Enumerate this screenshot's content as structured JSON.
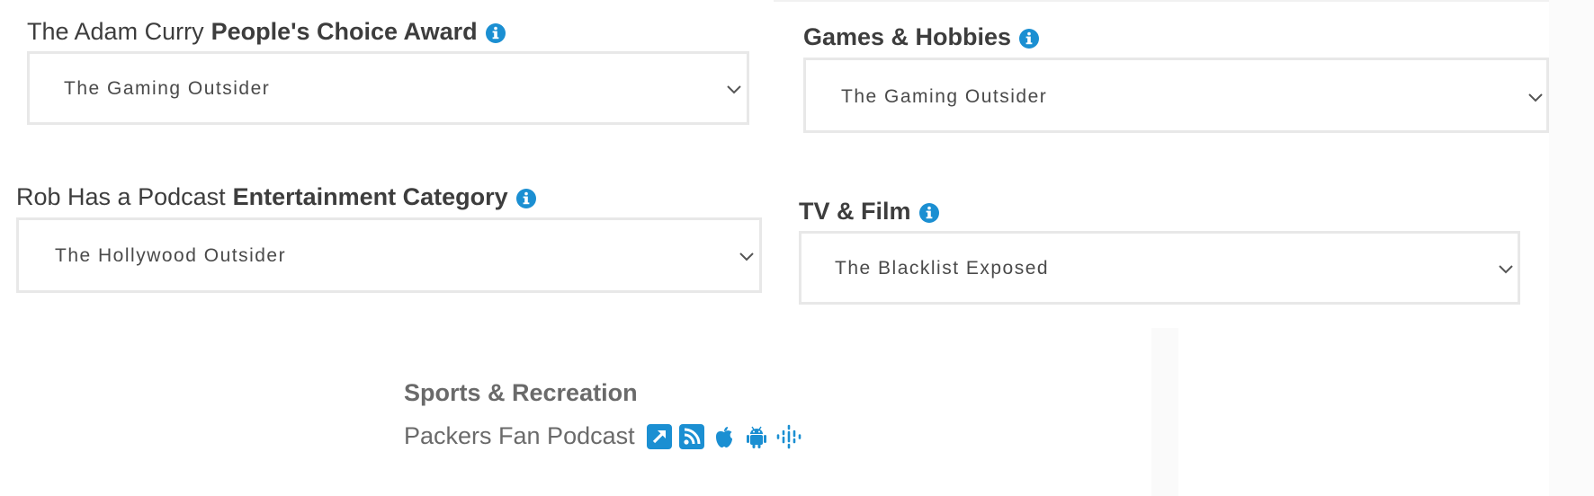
{
  "colors": {
    "accent": "#1b8fd2",
    "label_text": "#3d3d3d",
    "muted_text": "#6a6a6a",
    "select_border": "#e8e8e8"
  },
  "fields": {
    "peoples_choice": {
      "label_light": "The Adam Curry",
      "label_bold": "People's Choice Award",
      "selected": "The Gaming Outsider"
    },
    "games_hobbies": {
      "label_bold": "Games & Hobbies",
      "selected": "The Gaming Outsider"
    },
    "entertainment": {
      "label_light": "Rob Has a Podcast",
      "label_bold": "Entertainment Category",
      "selected": "The Hollywood Outsider"
    },
    "tv_film": {
      "label_bold": "TV & Film",
      "selected": "The Blacklist Exposed"
    }
  },
  "sports": {
    "title": "Sports & Recreation",
    "podcast_name": "Packers Fan Podcast",
    "icons": [
      "external-link-icon",
      "rss-icon",
      "apple-icon",
      "android-icon",
      "google-podcasts-icon"
    ]
  }
}
